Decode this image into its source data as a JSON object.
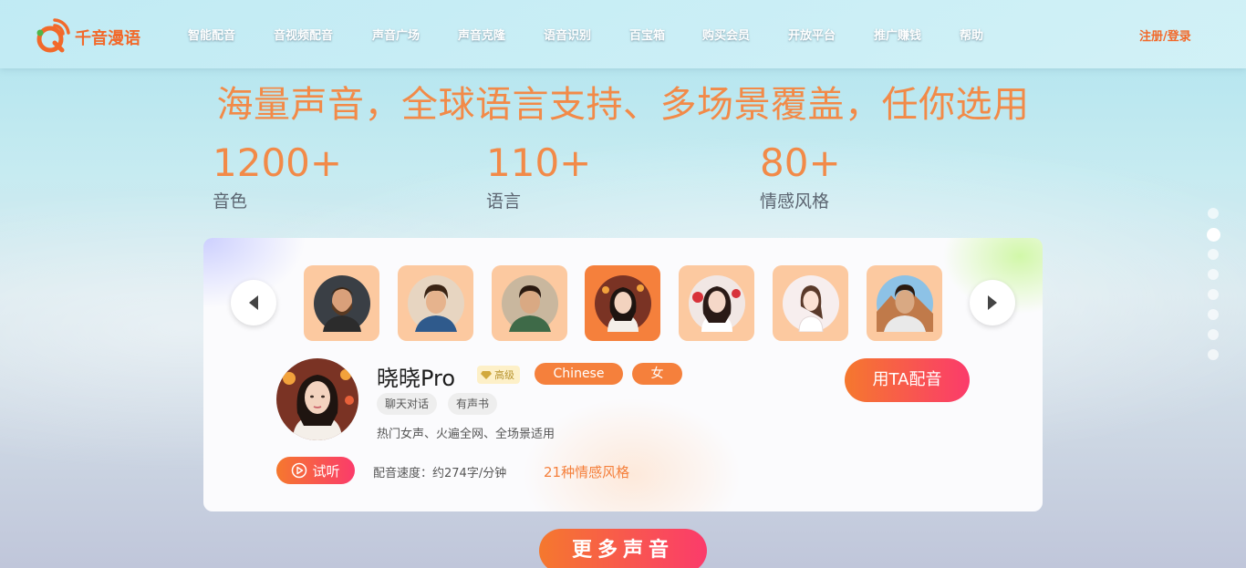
{
  "header": {
    "brand": "千音漫语",
    "nav": [
      "智能配音",
      "音视频配音",
      "声音广场",
      "声音克隆",
      "语音识别",
      "百宝箱",
      "购买会员",
      "开放平台",
      "推广赚钱",
      "帮助"
    ],
    "login": "注册/登录"
  },
  "hero": {
    "headline": "海量声音，全球语言支持、多场景覆盖，任你选用",
    "stats": [
      {
        "value": "1200+",
        "label": "音色"
      },
      {
        "value": "110+",
        "label": "语言"
      },
      {
        "value": "80+",
        "label": "情感风格"
      }
    ]
  },
  "pagination": {
    "count": 8,
    "active_index": 1
  },
  "carousel": {
    "thumbnails": [
      {
        "icon": "avatar-bearded-man-icon"
      },
      {
        "icon": "avatar-young-man-icon"
      },
      {
        "icon": "avatar-man-green-jacket-icon"
      },
      {
        "icon": "avatar-xiaoxiao-icon",
        "selected": true
      },
      {
        "icon": "avatar-woman-red-flowers-icon"
      },
      {
        "icon": "avatar-cartoon-girl-icon"
      },
      {
        "icon": "avatar-man-mountains-icon"
      }
    ]
  },
  "voice": {
    "name": "晓晓Pro",
    "level": "高级",
    "language": "Chinese",
    "gender": "女",
    "tags": [
      "聊天对话",
      "有声书"
    ],
    "description": "热门女声、火遍全网、全场景适用",
    "use_button": "用TA配音",
    "listen_button": "试听",
    "speed": "配音速度：约274字/分钟",
    "emotions": "21种情感风格"
  },
  "more_button": "更多声音",
  "colors": {
    "accent": "#f5803c",
    "gradient_end": "#fb3b6b",
    "headline": "#f28a48"
  }
}
